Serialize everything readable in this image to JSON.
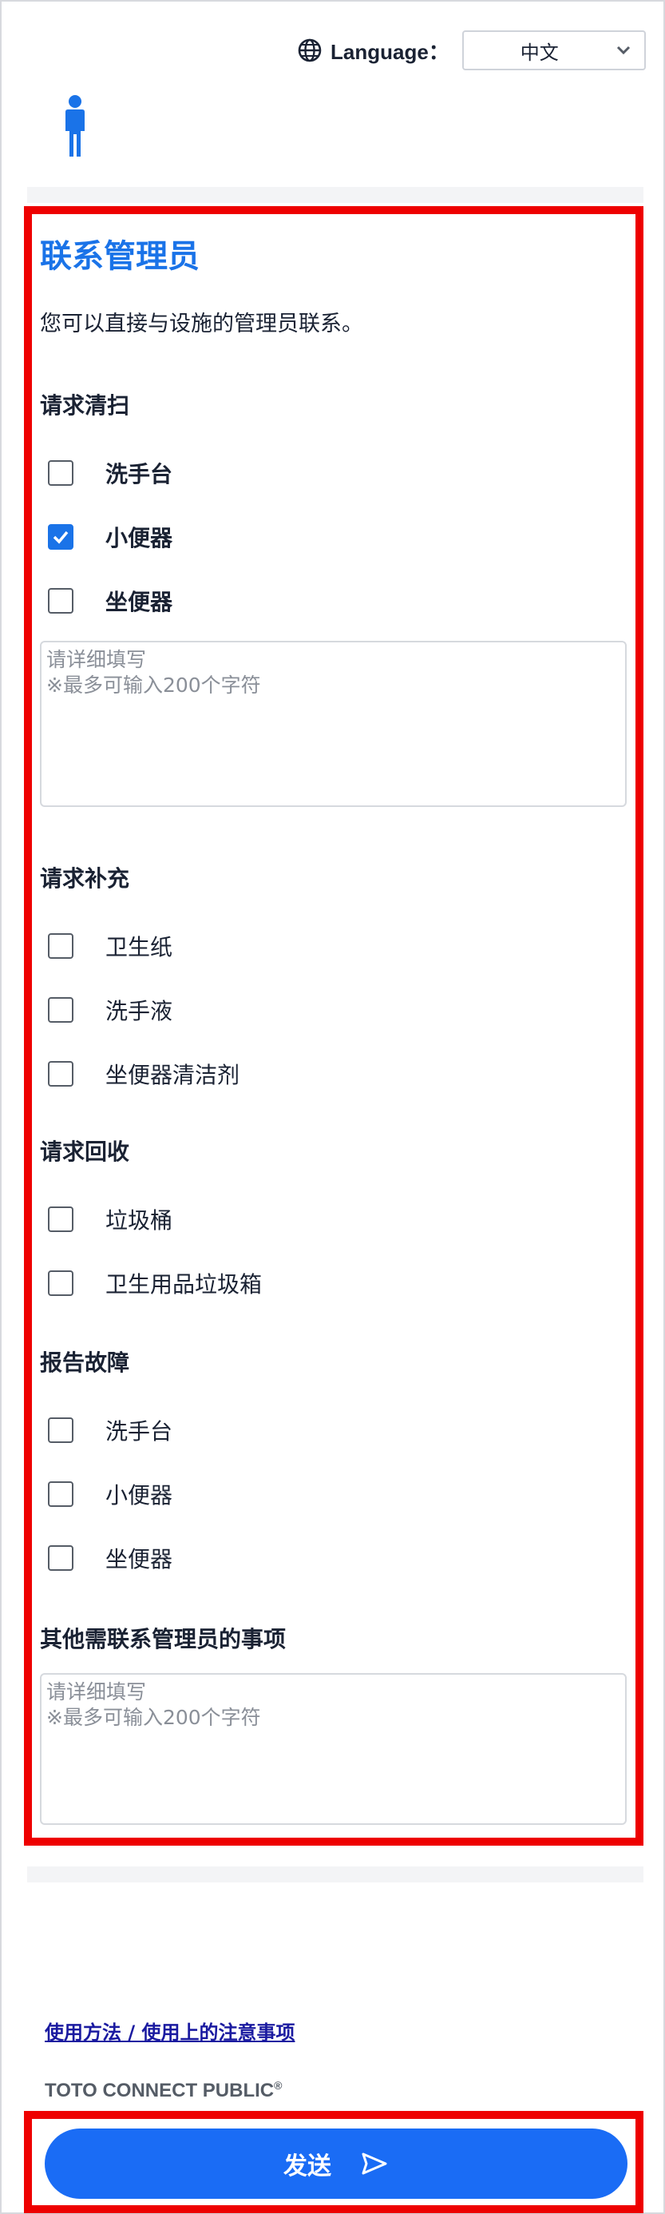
{
  "header": {
    "language_label": "Language：",
    "language_value": "中文"
  },
  "form": {
    "title": "联系管理员",
    "intro": "您可以直接与设施的管理员联系。",
    "sections": [
      {
        "heading": "请求清扫",
        "options": [
          {
            "label": "洗手台",
            "checked": false
          },
          {
            "label": "小便器",
            "checked": true
          },
          {
            "label": "坐便器",
            "checked": false
          }
        ]
      },
      {
        "heading": "请求补充",
        "options": [
          {
            "label": "卫生纸",
            "checked": false
          },
          {
            "label": "洗手液",
            "checked": false
          },
          {
            "label": "坐便器清洁剂",
            "checked": false
          }
        ]
      },
      {
        "heading": "请求回收",
        "options": [
          {
            "label": "垃圾桶",
            "checked": false
          },
          {
            "label": "卫生用品垃圾箱",
            "checked": false
          }
        ]
      },
      {
        "heading": "报告故障",
        "options": [
          {
            "label": "洗手台",
            "checked": false
          },
          {
            "label": "小便器",
            "checked": false
          },
          {
            "label": "坐便器",
            "checked": false
          }
        ]
      }
    ],
    "cleaning_textarea_placeholder_line1": "请详细填写",
    "cleaning_textarea_placeholder_line2": "※最多可输入200个字符",
    "other_heading": "其他需联系管理员的事项",
    "other_textarea_placeholder_line1": "请详细填写",
    "other_textarea_placeholder_line2": "※最多可输入200个字符"
  },
  "footer": {
    "help_link": "使用方法 / 使用上的注意事项",
    "brand": "TOTO CONNECT PUBLIC",
    "brand_mark": "®",
    "send_label": "发送"
  },
  "colors": {
    "accent": "#1a73e8",
    "button": "#1a6cf5",
    "highlight": "#ee0000"
  }
}
